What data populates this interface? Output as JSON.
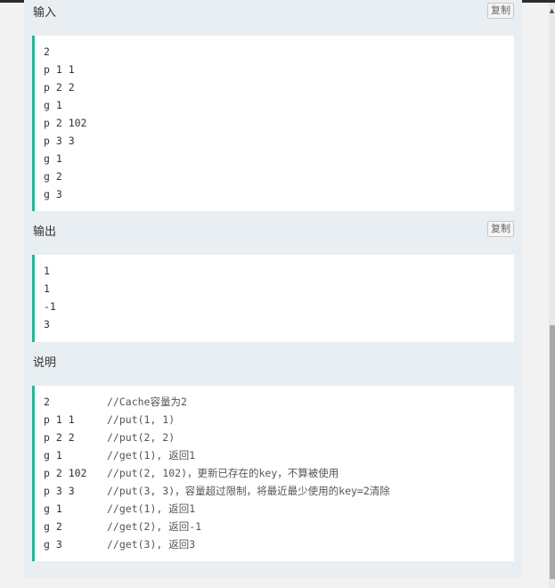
{
  "input": {
    "title": "输入",
    "copy_label": "复制",
    "lines": [
      "2",
      "p 1 1",
      "p 2 2",
      "g 1",
      "p 2 102",
      "p 3 3",
      "g 1",
      "g 2",
      "g 3"
    ]
  },
  "output": {
    "title": "输出",
    "copy_label": "复制",
    "lines": [
      "1",
      "1",
      "-1",
      "3"
    ]
  },
  "explanation": {
    "title": "说明",
    "lines": [
      {
        "cmd": "2",
        "comment": "//Cache容量为2"
      },
      {
        "cmd": "p 1 1",
        "comment": "//put(1, 1)"
      },
      {
        "cmd": "p 2 2",
        "comment": "//put(2, 2)"
      },
      {
        "cmd": "g 1",
        "comment": "//get(1), 返回1"
      },
      {
        "cmd": "p 2 102",
        "comment": "//put(2, 102)，更新已存在的key，不算被使用"
      },
      {
        "cmd": "p 3 3",
        "comment": "//put(3, 3)，容量超过限制，将最近最少使用的key=2清除"
      },
      {
        "cmd": "g 1",
        "comment": "//get(1), 返回1"
      },
      {
        "cmd": "g 2",
        "comment": "//get(2), 返回-1"
      },
      {
        "cmd": "g 3",
        "comment": "//get(3), 返回3"
      }
    ]
  },
  "colors": {
    "accent_border": "#2bb495",
    "panel_bg": "#e9eef2",
    "code_bg": "#ffffff"
  }
}
